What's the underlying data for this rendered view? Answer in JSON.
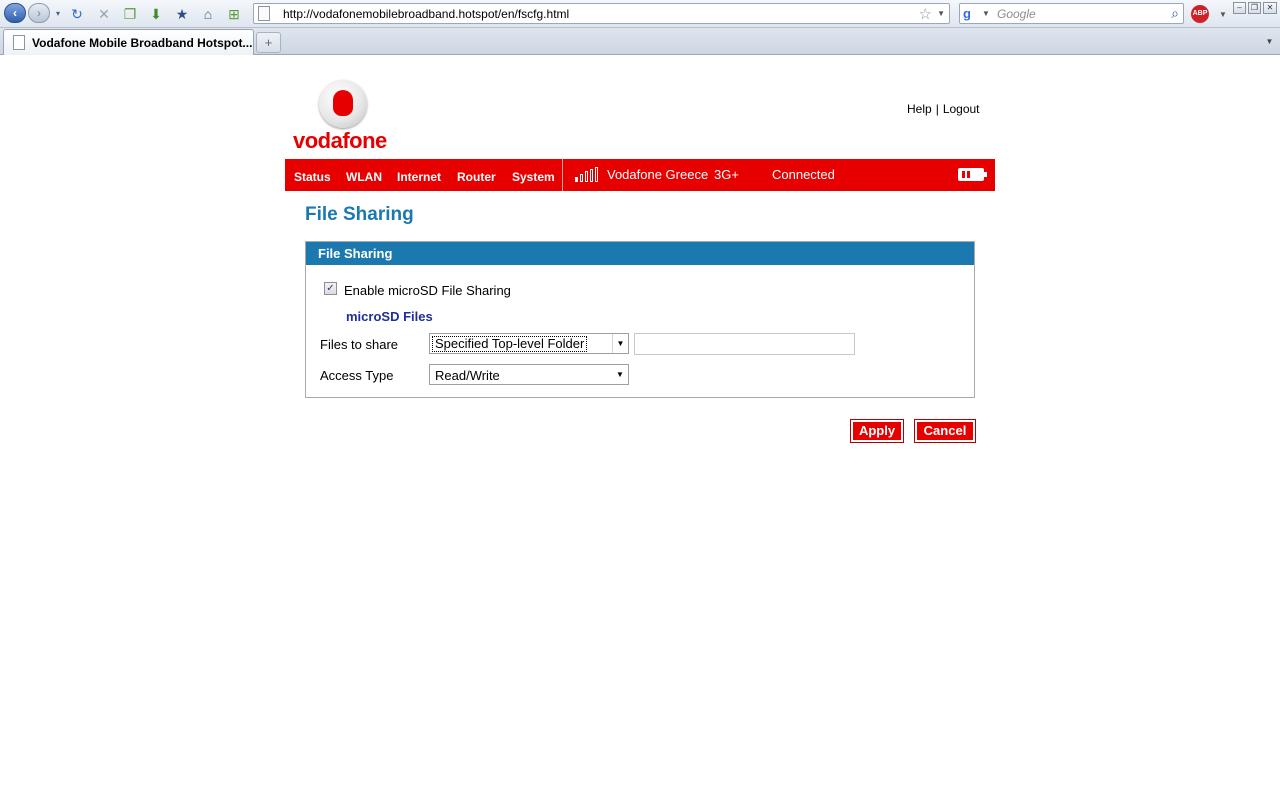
{
  "browser": {
    "url": "http://vodafonemobilebroadband.hotspot/en/fscfg.html",
    "search_placeholder": "Google",
    "tab_title": "Vodafone Mobile Broadband Hotspot...",
    "new_tab_glyph": "+",
    "abp_label": "ABP"
  },
  "header": {
    "logo_text": "vodafone",
    "help_label": "Help",
    "separator": "|",
    "logout_label": "Logout"
  },
  "nav": {
    "items": [
      "Status",
      "WLAN",
      "Internet",
      "Router",
      "System"
    ],
    "network_name": "Vodafone Greece",
    "network_type": "3G+",
    "connection_status": "Connected"
  },
  "page": {
    "title": "File Sharing",
    "panel_title": "File Sharing",
    "enable_label": "Enable microSD File Sharing",
    "enable_checked": true,
    "section_heading": "microSD Files",
    "files_label": "Files to share",
    "files_value": "Specified Top-level Folder",
    "folder_value": "",
    "access_label": "Access Type",
    "access_value": "Read/Write"
  },
  "actions": {
    "apply_label": "Apply",
    "cancel_label": "Cancel"
  },
  "colors": {
    "brand_red": "#e60000",
    "panel_blue": "#1b79b0",
    "heading_navy": "#1d2f9a"
  }
}
